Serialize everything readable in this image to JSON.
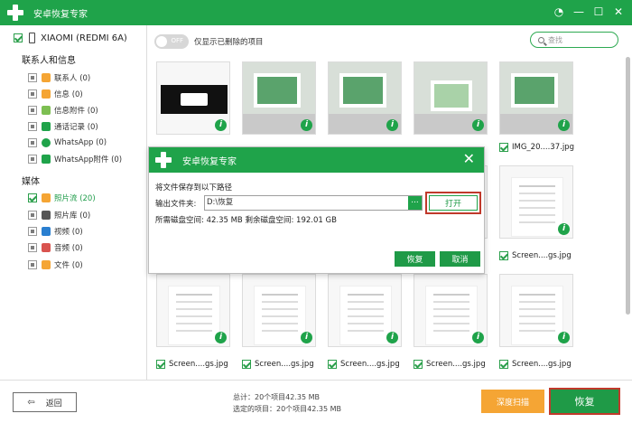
{
  "app": {
    "title": "安卓恢复专家"
  },
  "window_controls": {
    "minimize": "—",
    "maximize": "☐",
    "close": "✕"
  },
  "device": {
    "name": "XIAOMI (REDMI 6A)"
  },
  "sidebar": {
    "section_contacts": "联系人和信息",
    "contacts_items": [
      {
        "label": "联系人 (0)",
        "icon": "contacts-icon",
        "color": "#f5a534"
      },
      {
        "label": "信息 (0)",
        "icon": "messages-icon",
        "color": "#f5a534"
      },
      {
        "label": "信息附件 (0)",
        "icon": "message-attachments-icon",
        "color": "#7dbf52"
      },
      {
        "label": "通话记录 (0)",
        "icon": "call-log-icon",
        "color": "#1fa34a"
      },
      {
        "label": "WhatsApp (0)",
        "icon": "whatsapp-icon",
        "color": "#1fa34a"
      },
      {
        "label": "WhatsApp附件 (0)",
        "icon": "whatsapp-attachments-icon",
        "color": "#1fa34a"
      }
    ],
    "section_media": "媒体",
    "media_items": [
      {
        "label": "照片流 (20)",
        "icon": "photo-stream-icon",
        "color": "#f5a534"
      },
      {
        "label": "照片库 (0)",
        "icon": "photo-library-icon",
        "color": "#555555"
      },
      {
        "label": "视频 (0)",
        "icon": "video-icon",
        "color": "#2a7fd0"
      },
      {
        "label": "音频 (0)",
        "icon": "audio-icon",
        "color": "#d9534f"
      },
      {
        "label": "文件 (0)",
        "icon": "files-icon",
        "color": "#f5a534"
      }
    ]
  },
  "main": {
    "toggle_state": "OFF",
    "toggle_label": "仅显示已删除的项目",
    "search_placeholder": "查找",
    "tiles": [
      {
        "label": "",
        "style": "dark"
      },
      {
        "label": "",
        "style": "photo"
      },
      {
        "label": "",
        "style": "photo"
      },
      {
        "label": "",
        "style": "photo green"
      },
      {
        "label": "IMG_20....37.jpg",
        "style": "photo"
      },
      {
        "label": "",
        "style": "screen"
      },
      {
        "label": "",
        "style": "screen"
      },
      {
        "label": "",
        "style": "screen"
      },
      {
        "label": "",
        "style": "screen"
      },
      {
        "label": "Screen....gs.jpg",
        "style": "screen"
      },
      {
        "label": "Screen....gs.jpg",
        "style": "screen"
      },
      {
        "label": "Screen....gs.jpg",
        "style": "screen"
      },
      {
        "label": "Screen....gs.jpg",
        "style": "screen"
      },
      {
        "label": "Screen....gs.jpg",
        "style": "screen"
      },
      {
        "label": "Screen....gs.jpg",
        "style": "screen"
      }
    ]
  },
  "dialog": {
    "title": "安卓恢复专家",
    "close": "✕",
    "prompt": "将文件保存到以下路径",
    "output_label": "输出文件夹:",
    "output_path": "D:\\恢复",
    "dots": "...",
    "open_button": "打开",
    "disk_info": "所需磁盘空间:  42.35 MB  剩余磁盘空间:  192.01 GB",
    "recover_button": "恢复",
    "cancel_button": "取消"
  },
  "footer": {
    "back_button": "返回",
    "total_line": "总计：20个项目42.35 MB",
    "selected_line": "选定的项目：20个项目42.35 MB",
    "deep_scan_button": "深度扫描",
    "recover_button": "恢复"
  }
}
